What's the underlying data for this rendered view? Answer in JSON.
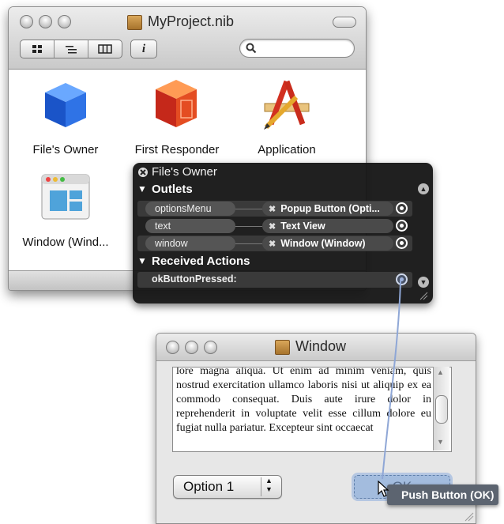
{
  "nib_window": {
    "title": "MyProject.nib",
    "view_modes": [
      "icon-view",
      "list-view",
      "column-view"
    ],
    "info_button": "i",
    "search": {
      "value": "",
      "placeholder": ""
    },
    "objects": [
      {
        "label": "File's Owner",
        "icon": "cube-icon"
      },
      {
        "label": "First Responder",
        "icon": "red-cube-icon"
      },
      {
        "label": "Application",
        "icon": "application-icon"
      },
      {
        "label": "Window (Wind...",
        "icon": "window-icon"
      }
    ]
  },
  "connections_panel": {
    "title": "File's Owner",
    "outlets_header": "Outlets",
    "outlets": [
      {
        "name": "optionsMenu",
        "target": "Popup Button (Opti..."
      },
      {
        "name": "text",
        "target": "Text View"
      },
      {
        "name": "window",
        "target": "Window (Window)"
      }
    ],
    "actions_header": "Received Actions",
    "actions": [
      {
        "name": "okButtonPressed:"
      }
    ]
  },
  "window_editor": {
    "title": "Window",
    "text_content": "lore magna aliqua. Ut enim ad minim veniam, quis nostrud exercitation ullamco laboris nisi ut aliquip ex ea commodo consequat. Duis aute irure dolor in reprehenderit in voluptate velit esse cillum dolore eu fugiat nulla pariatur. Excepteur sint occaecat",
    "popup_value": "Option 1",
    "ok_button": "OK"
  },
  "tooltip": "Push Button (OK)",
  "colors": {
    "hud_background": "#141414",
    "connection_line": "#8fa7d6",
    "ok_highlight": "#96b4dc"
  }
}
